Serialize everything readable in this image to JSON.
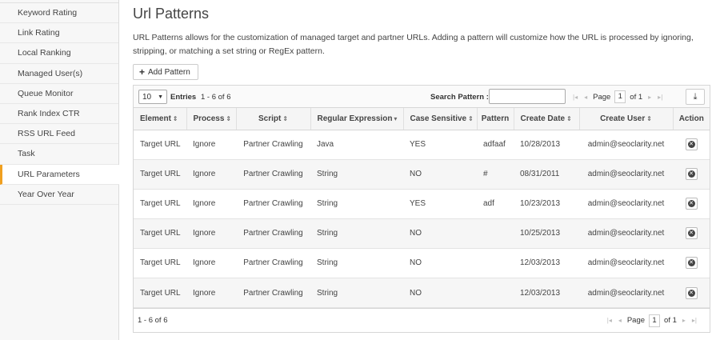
{
  "sidebar": {
    "items": [
      {
        "label": "Keyword Rating"
      },
      {
        "label": "Link Rating"
      },
      {
        "label": "Local Ranking"
      },
      {
        "label": "Managed User(s)"
      },
      {
        "label": "Queue Monitor"
      },
      {
        "label": "Rank Index CTR"
      },
      {
        "label": "RSS URL Feed"
      },
      {
        "label": "Task"
      },
      {
        "label": "URL Parameters"
      },
      {
        "label": "Year Over Year"
      }
    ],
    "active": "URL Parameters",
    "accent_color": "#f0a020"
  },
  "main": {
    "title": "Url Patterns",
    "description": "URL Patterns allows for the customization of managed target and partner URLs. Adding a pattern will customize how the URL is processed by ignoring, stripping, or matching a set string or RegEx pattern.",
    "add_button": "Add Pattern",
    "add_icon": "plus-icon"
  },
  "grid": {
    "page_size": "10",
    "entries_label": "Entries",
    "count_text": "1 - 6 of 6",
    "search_label": "Search Pattern :",
    "search_value": "",
    "page_label": "Page",
    "page_number": "1",
    "page_of": "of 1",
    "export_icon": "download-icon",
    "columns": [
      {
        "label": "Element",
        "sort": "⇕"
      },
      {
        "label": "Process",
        "sort": "⇕"
      },
      {
        "label": "Script",
        "sort": "⇕"
      },
      {
        "label": "Regular Expression",
        "sort": "▾"
      },
      {
        "label": "Case Sensitive",
        "sort": "⇕"
      },
      {
        "label": "Pattern",
        "sort": ""
      },
      {
        "label": "Create Date",
        "sort": "⇕"
      },
      {
        "label": "Create User",
        "sort": "⇕"
      },
      {
        "label": "Action",
        "sort": ""
      }
    ],
    "rows": [
      {
        "element": "Target URL",
        "process": "Ignore",
        "script": "Partner Crawling",
        "regex": "Java",
        "case": "YES",
        "pattern": "adfaaf",
        "date": "10/28/2013",
        "user": "admin@seoclarity.net"
      },
      {
        "element": "Target URL",
        "process": "Ignore",
        "script": "Partner Crawling",
        "regex": "String",
        "case": "NO",
        "pattern": "#",
        "date": "08/31/2011",
        "user": "admin@seoclarity.net"
      },
      {
        "element": "Target URL",
        "process": "Ignore",
        "script": "Partner Crawling",
        "regex": "String",
        "case": "YES",
        "pattern": "adf",
        "date": "10/23/2013",
        "user": "admin@seoclarity.net"
      },
      {
        "element": "Target URL",
        "process": "Ignore",
        "script": "Partner Crawling",
        "regex": "String",
        "case": "NO",
        "pattern": "",
        "date": "10/25/2013",
        "user": "admin@seoclarity.net"
      },
      {
        "element": "Target URL",
        "process": "Ignore",
        "script": "Partner Crawling",
        "regex": "String",
        "case": "NO",
        "pattern": "",
        "date": "12/03/2013",
        "user": "admin@seoclarity.net"
      },
      {
        "element": "Target URL",
        "process": "Ignore",
        "script": "Partner Crawling",
        "regex": "String",
        "case": "NO",
        "pattern": "",
        "date": "12/03/2013",
        "user": "admin@seoclarity.net"
      }
    ],
    "footer_count": "1 - 6 of 6"
  }
}
